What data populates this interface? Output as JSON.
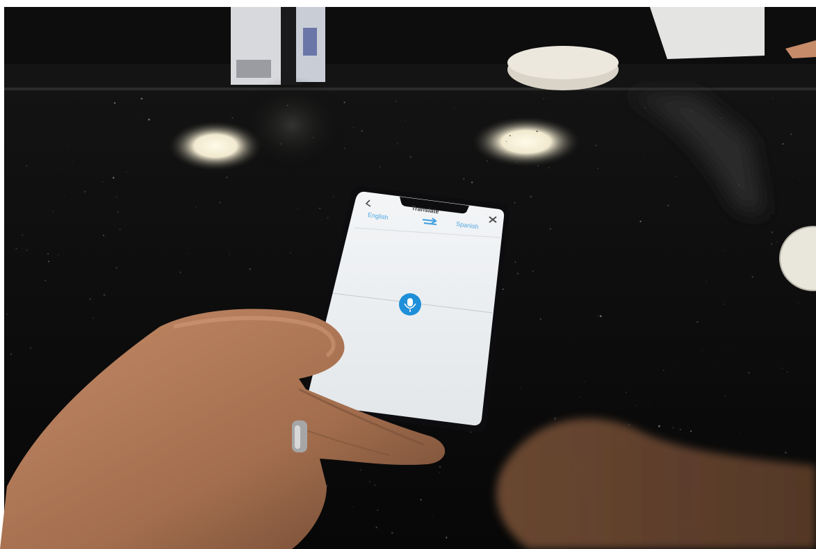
{
  "photo": {
    "subject": "hand holding smartphone on dark granite counter",
    "colors": {
      "counter": "#0b0b0c",
      "screen": "#eef1f4",
      "accent": "#1e8fd8",
      "skin": "#b9805d"
    }
  },
  "phone_screen": {
    "title": "Translate",
    "source_language": "English",
    "target_language": "Spanish",
    "swap_icon": "swap-arrows-icon",
    "close_icon": "close-icon",
    "mic_icon": "microphone-icon"
  }
}
